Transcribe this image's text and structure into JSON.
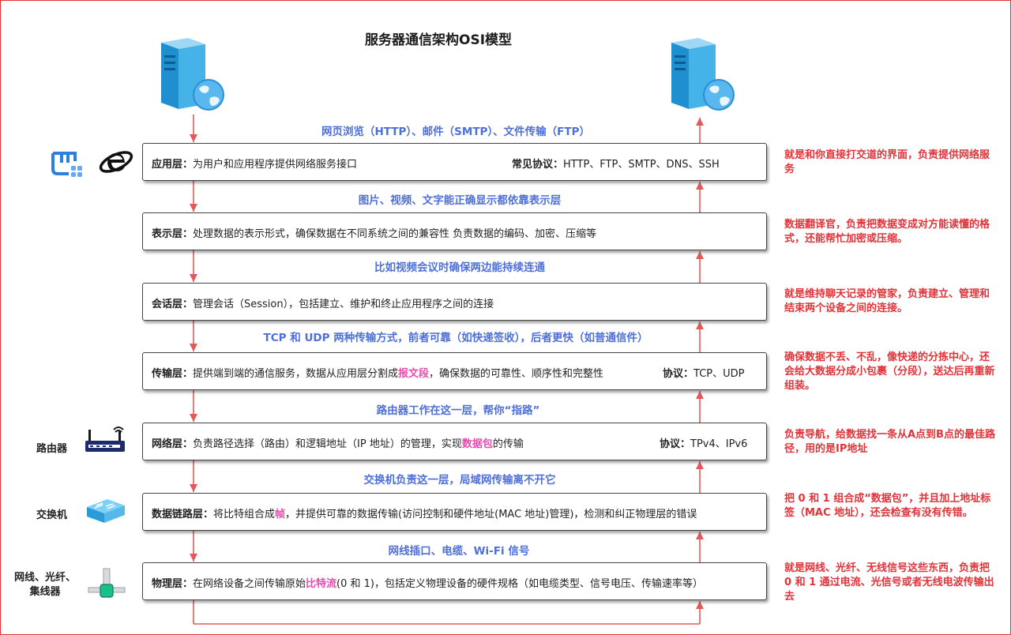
{
  "title": "服务器通信架构OSI模型",
  "colors": {
    "protocol_text": "#4e6fd8",
    "note_text": "#e0343a",
    "highlight": "#e84ab0",
    "arrow": "#e05a5a",
    "frame": "#e0343a"
  },
  "icons": {
    "servers": [
      "server-globe-icon",
      "server-globe-icon"
    ],
    "app_layer": [
      "app-window-icon",
      "internet-explorer-icon"
    ],
    "devices": [
      "router-icon",
      "switch-icon",
      "cable-hub-icon"
    ]
  },
  "protocols": [
    "网页浏览（HTTP）、邮件（SMTP）、文件传输（FTP）",
    "图片、视频、文字能正确显示都依靠表示层",
    "比如视频会议时确保两边能持续连通",
    "TCP 和 UDP 两种传输方式，前者可靠（如快递签收），后者更快（如普通信件）",
    "路由器工作在这一层，帮你“指路”",
    "交换机负责这一层，局域网传输离不开它",
    "网线插口、电缆、Wi-Fi 信号"
  ],
  "layers": [
    {
      "name": "应用层：",
      "desc_before": "为用户和应用程序提供网络服务接口",
      "highlight": "",
      "desc_after": "",
      "extra_label": "常见协议：",
      "extra_value": "HTTP、FTP、SMTP、DNS、SSH",
      "note": "就是和你直接打交道的界面，负责提供网络服务"
    },
    {
      "name": "表示层：",
      "desc_before": "处理数据的表示形式，确保数据在不同系统之间的兼容性  负责数据的编码、加密、压缩等",
      "highlight": "",
      "desc_after": "",
      "extra_label": "",
      "extra_value": "",
      "note": "数据翻译官，负责把数据变成对方能读懂的格式，还能帮忙加密或压缩。"
    },
    {
      "name": "会话层：",
      "desc_before": "管理会话（Session），包括建立、维护和终止应用程序之间的连接",
      "highlight": "",
      "desc_after": "",
      "extra_label": "",
      "extra_value": "",
      "note": "就是维持聊天记录的管家，负责建立、管理和结束两个设备之间的连接。"
    },
    {
      "name": "传输层：",
      "desc_before": "提供端到端的通信服务，数据从应用层分割成",
      "highlight": "报文段",
      "desc_after": "，确保数据的可靠性、顺序性和完整性",
      "extra_label": "协议：",
      "extra_value": "TCP、UDP",
      "note": "确保数据不丢、不乱，像快递的分拣中心，还会给大数据分成小包裹（分段），送达后再重新组装。"
    },
    {
      "name": "网络层：",
      "desc_before": "负责路径选择（路由）和逻辑地址（IP 地址）的管理，实现",
      "highlight": "数据包",
      "desc_after": "的传输",
      "extra_label": "协议：",
      "extra_value": "TPv4、IPv6",
      "note": "负责导航，给数据找一条从A点到B点的最佳路径，用的是IP地址"
    },
    {
      "name": "数据链路层：",
      "desc_before": "将比特组合成",
      "highlight": "帧",
      "desc_after": "，并提供可靠的数据传输(访问控制和硬件地址(MAC 地址)管理)，检测和纠正物理层的错误",
      "extra_label": "",
      "extra_value": "",
      "note": "把 0 和 1 组合成“数据包”，并且加上地址标签（MAC 地址），还会检查有没有传错。"
    },
    {
      "name": "物理层：",
      "desc_before": "在网络设备之间传输原始",
      "highlight": "比特流",
      "desc_after": "(0 和 1)，包括定义物理设备的硬件规格（如电缆类型、信号电压、传输速率等）",
      "extra_label": "",
      "extra_value": "",
      "note": "就是网线、光纤、无线信号这些东西，负责把 0 和 1 通过电流、光信号或者无线电波传输出去"
    }
  ],
  "devices": {
    "router": "路由器",
    "switch": "交换机",
    "cable_line1": "网线、光纤、",
    "cable_line2": "集线器"
  }
}
